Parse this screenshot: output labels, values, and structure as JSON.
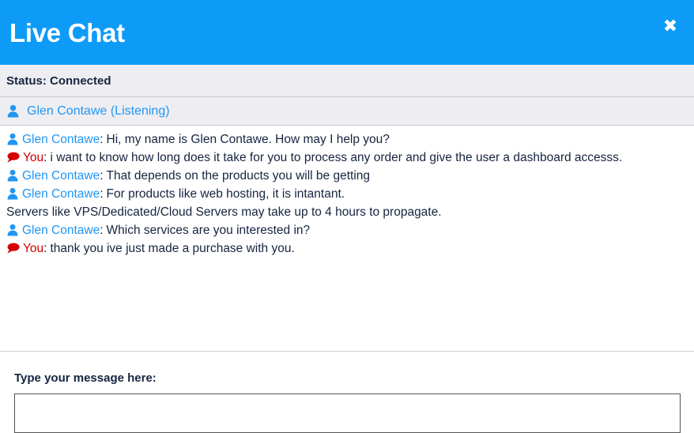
{
  "window": {
    "title": "Live Chat",
    "close_label": "✖",
    "header_color": "#0d9bf7"
  },
  "status": {
    "text": "Status: Connected"
  },
  "participants": [
    {
      "icon": "person-icon",
      "label": "Glen Contawe (Listening)"
    }
  ],
  "messages": [
    {
      "icon": "person-icon",
      "sender": "Glen Contawe",
      "separator": ":",
      "text": "Hi, my name is Glen Contawe. How may I help you?",
      "role": "agent"
    },
    {
      "icon": "speech-bubble-icon",
      "sender": "You",
      "separator": ":",
      "text": "i want to know how long does it take for you to process any order and give the user a dashboard accesss.",
      "role": "you"
    },
    {
      "icon": "person-icon",
      "sender": "Glen Contawe",
      "separator": ":",
      "text": "That depends on the products you will be getting",
      "role": "agent"
    },
    {
      "icon": "person-icon",
      "sender": "Glen Contawe",
      "separator": ":",
      "text": "For products like web hosting, it is intantant.",
      "role": "agent"
    },
    {
      "icon": null,
      "sender": null,
      "separator": null,
      "text": "Servers like VPS/Dedicated/Cloud Servers may take up to 4 hours to propagate.",
      "role": "continuation"
    },
    {
      "icon": "person-icon",
      "sender": "Glen Contawe",
      "separator": ":",
      "text": "Which services are you interested in?",
      "role": "agent"
    },
    {
      "icon": "speech-bubble-icon",
      "sender": "You",
      "separator": ":",
      "text": "thank you ive just made a purchase with you.",
      "role": "you"
    }
  ],
  "composer": {
    "label": "Type your message here:",
    "value": "",
    "placeholder": ""
  },
  "colors": {
    "agent_name": "#2196f3",
    "you_name": "#d40000",
    "body_text": "#16243f",
    "panel_bg": "#eeeef2"
  }
}
